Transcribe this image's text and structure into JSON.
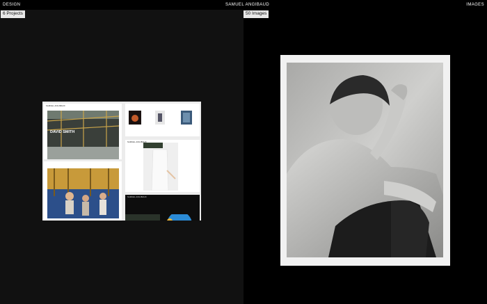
{
  "header": {
    "left_link": "DESIGN",
    "center_title": "SAMUEL ANGIBAUD",
    "right_link": "IMAGES"
  },
  "design_panel": {
    "count_label": "6 Projects",
    "mockups": {
      "main_label": "DAVID SMITH",
      "site_name": "SAMUEL ANGIBAUD"
    }
  },
  "images_panel": {
    "count_label": "50 Images"
  }
}
